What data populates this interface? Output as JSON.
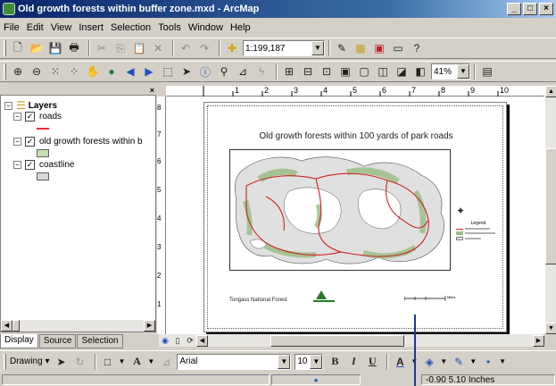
{
  "window": {
    "title": "Old growth forests within buffer zone.mxd - ArcMap",
    "minimize": "_",
    "maximize": "□",
    "close": "×"
  },
  "menu": [
    "File",
    "Edit",
    "View",
    "Insert",
    "Selection",
    "Tools",
    "Window",
    "Help"
  ],
  "standard_toolbar": {
    "scale_value": "1:199,187"
  },
  "layout_toolbar": {
    "zoom_value": "41%"
  },
  "toc": {
    "root_label": "Layers",
    "layers": [
      {
        "label": "roads",
        "checked": true,
        "symbol_color": "#e83030"
      },
      {
        "label": "old growth forests within b",
        "checked": true,
        "symbol_color": "#c8e0b0"
      },
      {
        "label": "coastline",
        "checked": true,
        "symbol_color": "#d8d8d8"
      }
    ],
    "tabs": [
      "Display",
      "Source",
      "Selection"
    ]
  },
  "ruler": {
    "h_ticks": [
      "1",
      "2",
      "3",
      "4",
      "5",
      "6",
      "7",
      "8",
      "9",
      "10"
    ],
    "v_ticks": [
      "8",
      "7",
      "6",
      "5",
      "4",
      "3",
      "2",
      "1"
    ]
  },
  "layout": {
    "map_title": "Old growth forests within 100 yards of park roads",
    "forest_label": "Tongass National Forest",
    "legend_title": "Legend",
    "scale_label": "Miles",
    "colors": {
      "land": "#e0e0e0",
      "forest": "#9cbf8a",
      "road": "#d02020",
      "coast": "#505050"
    }
  },
  "drawing_toolbar": {
    "drawing_label": "Drawing",
    "font_name": "Arial",
    "font_size": "10",
    "bold": "B",
    "italic": "I",
    "underline": "U"
  },
  "status_bar": {
    "coordinates": "-0.90  5.10 Inches"
  }
}
